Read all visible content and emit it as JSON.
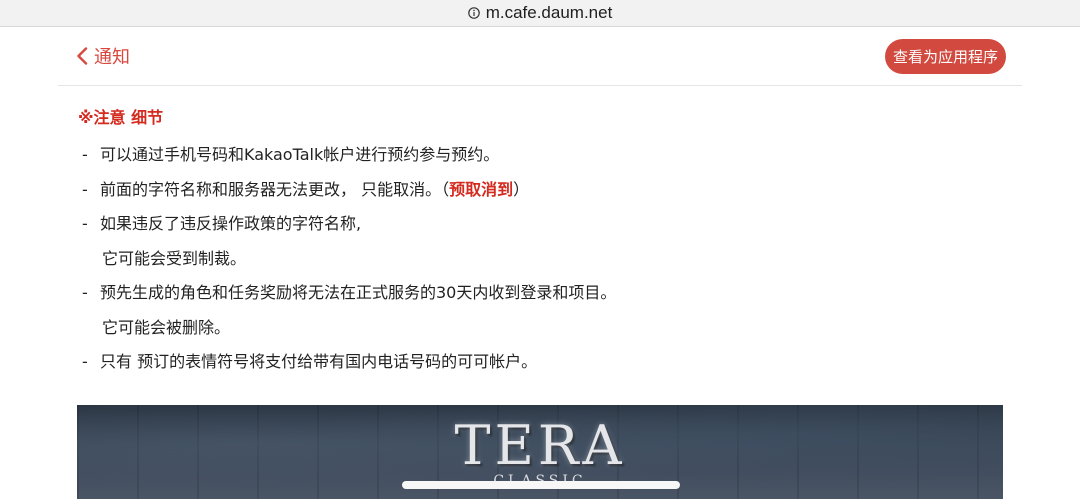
{
  "browser": {
    "url": "m.cafe.daum.net",
    "info_icon": "info-circle-icon"
  },
  "header": {
    "back_label": "通知",
    "back_icon": "chevron-left-icon",
    "app_button_label": "查看为应用程序",
    "accent_color": "#d24a3f"
  },
  "notice": {
    "title": "※注意 细节",
    "items": [
      {
        "dash": "-",
        "text": "可以通过手机号码和KakaoTalk帐户进行预约参与预约。"
      },
      {
        "dash": "-",
        "text_before": "前面的字符名称和服务器无法更改， 只能取消。（",
        "highlight": "预取消到",
        "text_after": "）"
      },
      {
        "dash": "-",
        "text": "如果违反了违反操作政策的字符名称,",
        "continuation": "它可能会受到制裁。"
      },
      {
        "dash": "-",
        "text": "预先生成的角色和任务奖励将无法在正式服务的30天内收到登录和项目。",
        "continuation": "它可能会被删除。"
      },
      {
        "dash": "-",
        "text": "只有 预订的表情符号将支付给带有国内电话号码的可可帐户。"
      }
    ]
  },
  "banner": {
    "logo_text": "TERA",
    "logo_subtext": "CLASSIC"
  }
}
